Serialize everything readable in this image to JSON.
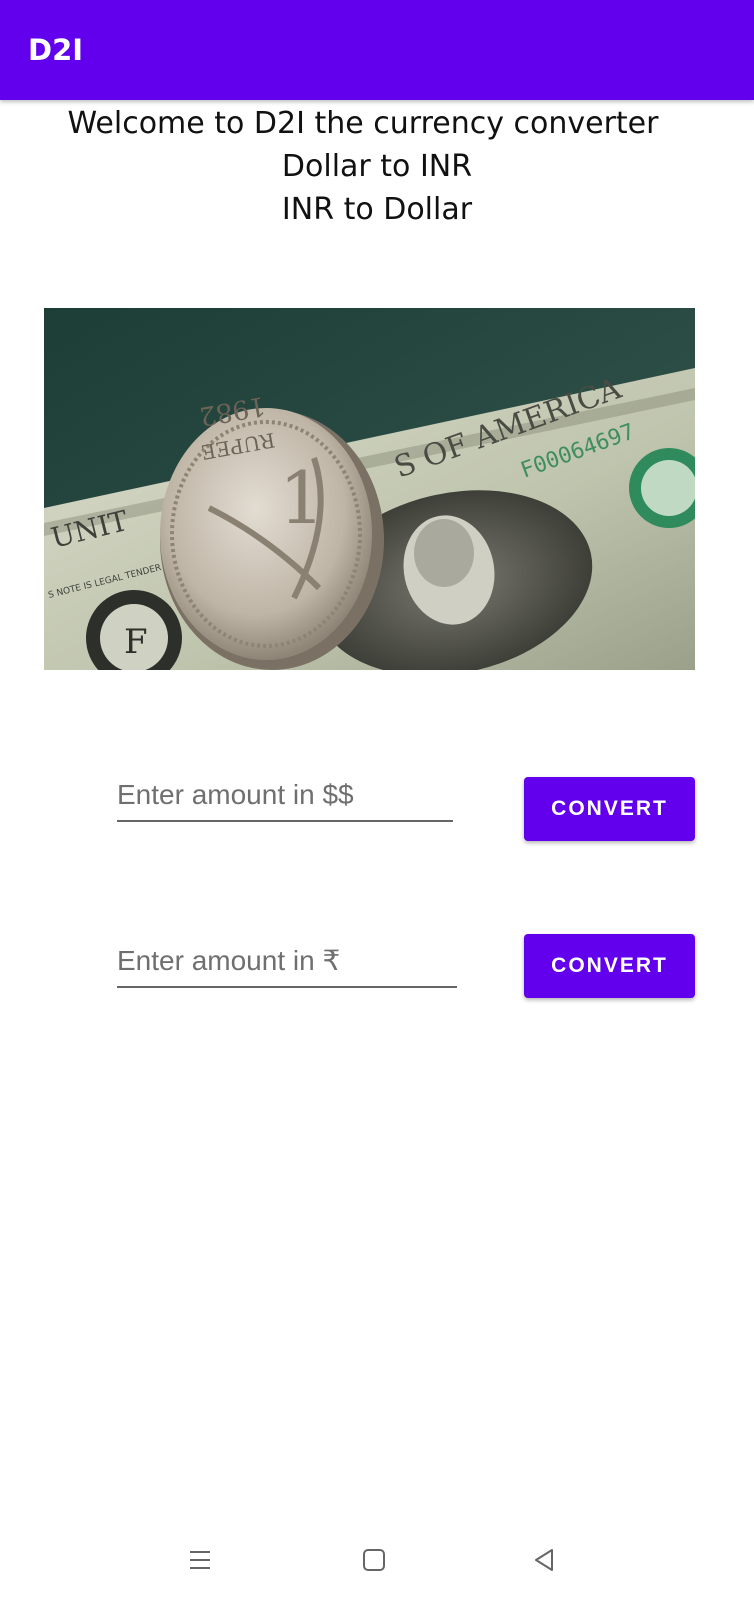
{
  "app_bar": {
    "title": "D2I",
    "color": "#6200ee"
  },
  "welcome": {
    "line1": "Welcome to D2I the currency converter",
    "line2": "Dollar to INR",
    "line3": "INR to Dollar"
  },
  "hero_image": {
    "description_icon": "rupee-coin-on-dollar-bill-image"
  },
  "usd_input": {
    "placeholder": "Enter amount in $$",
    "value": ""
  },
  "usd_convert": {
    "label": "CONVERT"
  },
  "inr_input": {
    "placeholder": "Enter amount in ₹",
    "value": ""
  },
  "inr_convert": {
    "label": "CONVERT"
  },
  "nav_bar": {
    "menu_icon": "menu-icon",
    "home_icon": "home-square-icon",
    "back_icon": "back-triangle-icon"
  }
}
